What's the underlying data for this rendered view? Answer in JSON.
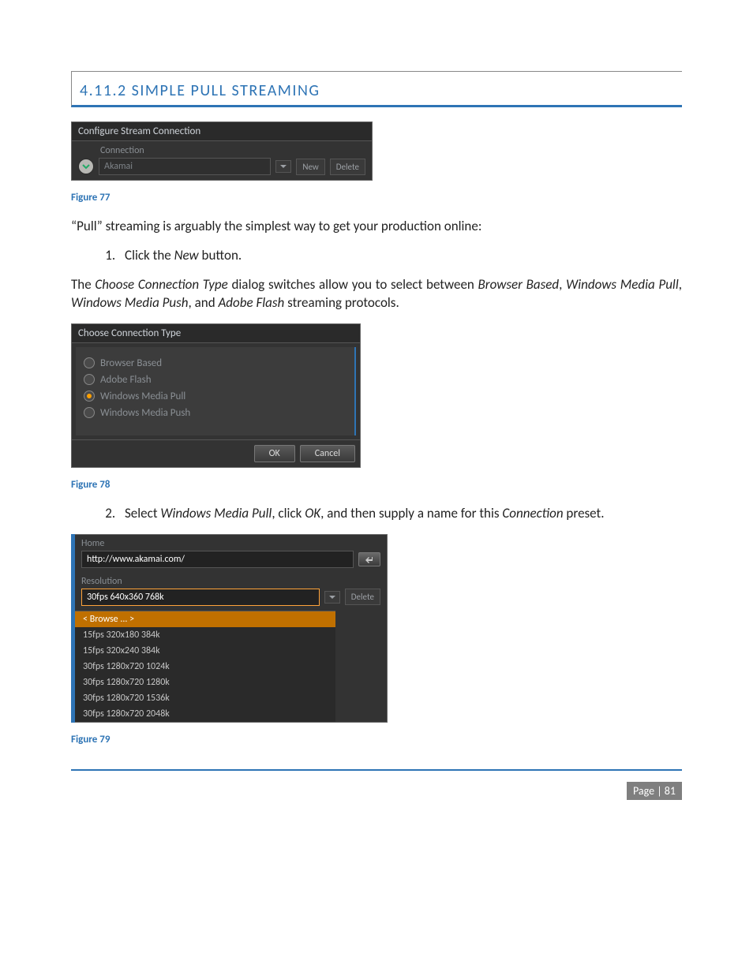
{
  "heading": "4.11.2 SIMPLE PULL STREAMING",
  "fig1": {
    "title": "Configure Stream Connection",
    "label": "Connection",
    "connection_value": "Akamai",
    "btn_new": "New",
    "btn_delete": "Delete"
  },
  "caption1": "Figure 77",
  "para1": "“Pull” streaming is arguably the simplest way to get your production online:",
  "step1_pre": "Click the ",
  "step1_italic": "New",
  "step1_post": " button.",
  "para2_a": "The ",
  "para2_i1": "Choose Connection Type",
  "para2_b": " dialog switches allow you to select between ",
  "para2_i2": "Browser Based",
  "para2_c": ", ",
  "para2_i3": "Windows Media Pull",
  "para2_d": ", ",
  "para2_i4": "Windows Media Push",
  "para2_e": ", and ",
  "para2_i5": "Adobe Flash",
  "para2_f": " streaming protocols.",
  "fig2": {
    "title": "Choose Connection Type",
    "opts": [
      "Browser Based",
      "Adobe Flash",
      "Windows Media Pull",
      "Windows Media Push"
    ],
    "selected": 2,
    "ok": "OK",
    "cancel": "Cancel"
  },
  "caption2": "Figure 78",
  "step2_pre": "Select ",
  "step2_i1": "Windows Media Pull",
  "step2_mid1": ", click ",
  "step2_i2": "OK",
  "step2_mid2": ", and then supply a name for this ",
  "step2_i3": "Connection",
  "step2_post": " preset.",
  "fig3": {
    "home_label": "Home",
    "url": "http://www.akamai.com/",
    "res_label": "Resolution",
    "res_value": "30fps 640x360 768k",
    "delete": "Delete",
    "options": [
      "< Browse ... >",
      "15fps 320x180 384k",
      "15fps 320x240 384k",
      "30fps 1280x720 1024k",
      "30fps 1280x720 1280k",
      "30fps 1280x720 1536k",
      "30fps 1280x720 2048k"
    ],
    "selected_option": 0
  },
  "caption3": "Figure 79",
  "footer": "Page | 81"
}
